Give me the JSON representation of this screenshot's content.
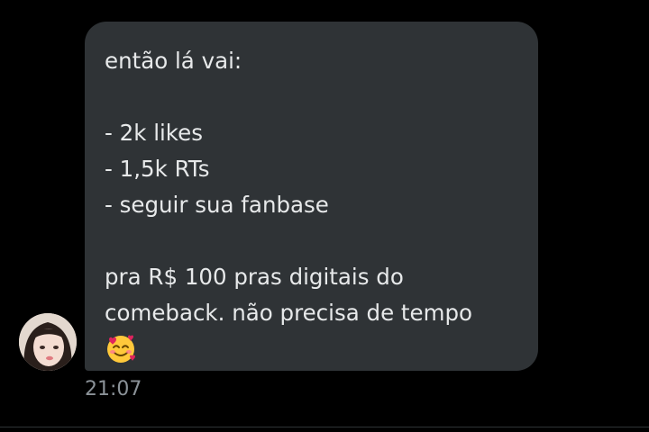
{
  "message": {
    "lines": [
      "então lá vai:",
      "",
      "- 2k likes",
      "- 1,5k RTs",
      "- seguir sua fanbase",
      "",
      "pra R$ 100 pras digitais do",
      "comeback. não precisa de tempo"
    ],
    "emoji": "smiling-face-with-hearts-icon",
    "timestamp": "21:07"
  },
  "sender": {
    "avatar": "avatar"
  },
  "colors": {
    "background": "#000000",
    "bubble": "#2f3336",
    "text": "#e7e9ea",
    "timestamp": "#8b9298"
  }
}
